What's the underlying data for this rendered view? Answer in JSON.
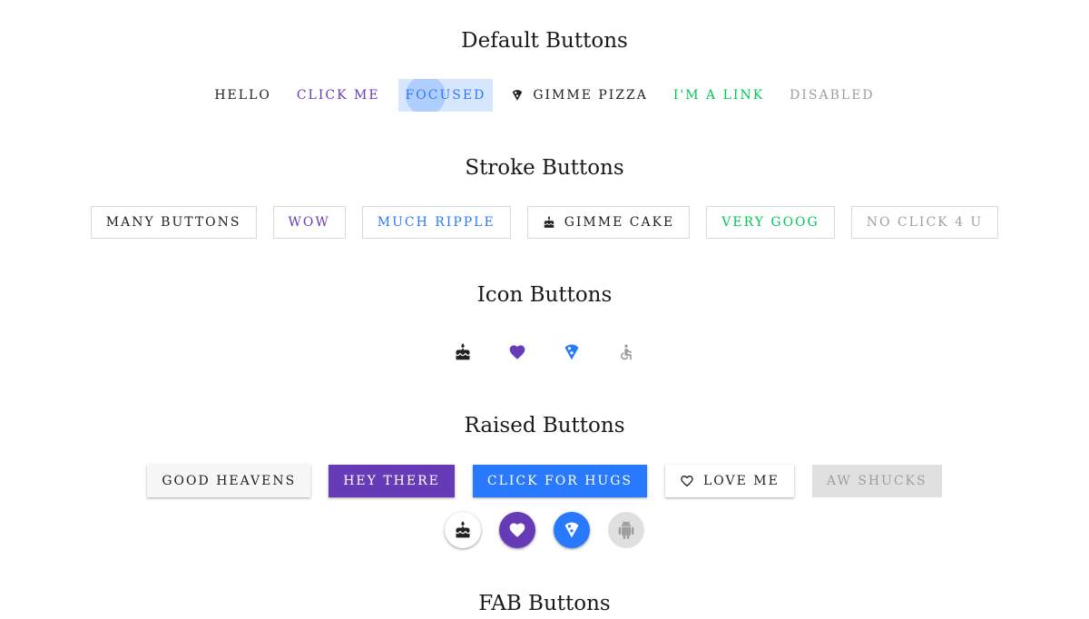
{
  "colors": {
    "primary": "#673ab7",
    "accent": "#2979ff",
    "success": "#00c853",
    "disabled": "#9e9e9e",
    "text": "#212121"
  },
  "sections": {
    "default": {
      "title": "Default Buttons",
      "buttons": [
        "HELLO",
        "CLICK ME",
        "FOCUSED",
        "GIMME PIZZA",
        "I'M A LINK",
        "DISABLED"
      ]
    },
    "stroke": {
      "title": "Stroke Buttons",
      "buttons": [
        "MANY BUTTONS",
        "WOW",
        "MUCH RIPPLE",
        "GIMME CAKE",
        "VERY GOOG",
        "NO CLICK 4 U"
      ]
    },
    "icon": {
      "title": "Icon Buttons",
      "icons": [
        "cake-icon",
        "heart-icon",
        "pizza-icon",
        "accessibility-icon"
      ]
    },
    "raised": {
      "title": "Raised Buttons",
      "buttons": [
        "GOOD HEAVENS",
        "HEY THERE",
        "CLICK FOR HUGS",
        "LOVE ME",
        "AW SHUCKS"
      ],
      "round_icons": [
        "cake-icon",
        "heart-icon",
        "pizza-icon",
        "android-icon"
      ]
    },
    "fab": {
      "title": "FAB Buttons"
    }
  }
}
